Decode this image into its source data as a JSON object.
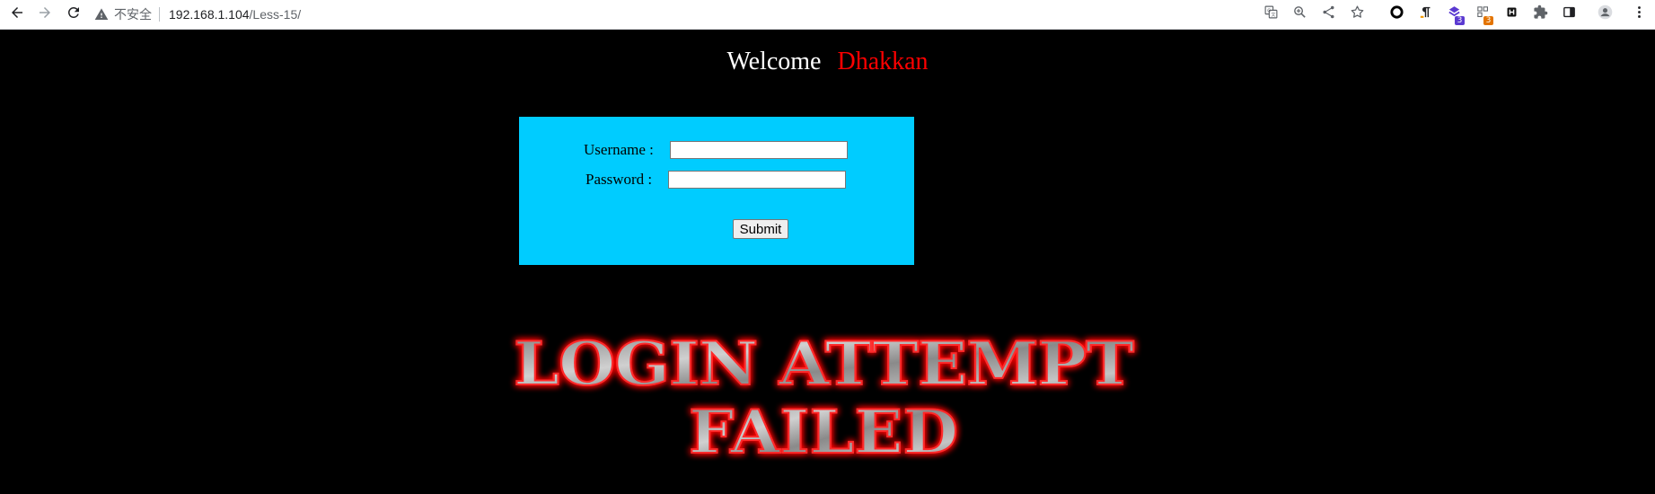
{
  "browser": {
    "back_icon": "arrow-left-icon",
    "forward_icon": "arrow-right-icon",
    "reload_icon": "reload-icon",
    "security_label": "不安全",
    "url_host": "192.168.1.104",
    "url_path": "/Less-15/",
    "extensions": [
      {
        "name": "translate-icon"
      },
      {
        "name": "zoom-icon"
      },
      {
        "name": "share-icon"
      },
      {
        "name": "bookmark-star-icon"
      },
      {
        "name": "extension-circle-icon"
      },
      {
        "name": "extension-paragraph-icon"
      },
      {
        "name": "extension-purple-icon",
        "badge": "3",
        "badge_color": "#5b3ad1"
      },
      {
        "name": "extension-grid-icon",
        "badge": "3",
        "badge_color": "#e37400"
      },
      {
        "name": "extension-h-icon"
      },
      {
        "name": "extensions-puzzle-icon"
      },
      {
        "name": "side-panel-icon"
      },
      {
        "name": "profile-avatar-icon"
      },
      {
        "name": "menu-kebab-icon"
      }
    ]
  },
  "page": {
    "welcome_word": "Welcome",
    "username_display": "Dhakkan",
    "welcome_color": "#ffffff",
    "username_color": "#ff0000",
    "background_color": "#000000"
  },
  "form": {
    "username_label": "Username :",
    "password_label": "Password :",
    "username_value": "",
    "password_value": "",
    "submit_label": "Submit",
    "box_color": "#00ccff"
  },
  "result": {
    "line1": "LOGIN ATTEMPT",
    "line2": "FAILED",
    "glow_color": "#ff0000",
    "text_color": "#9a9a9a"
  }
}
